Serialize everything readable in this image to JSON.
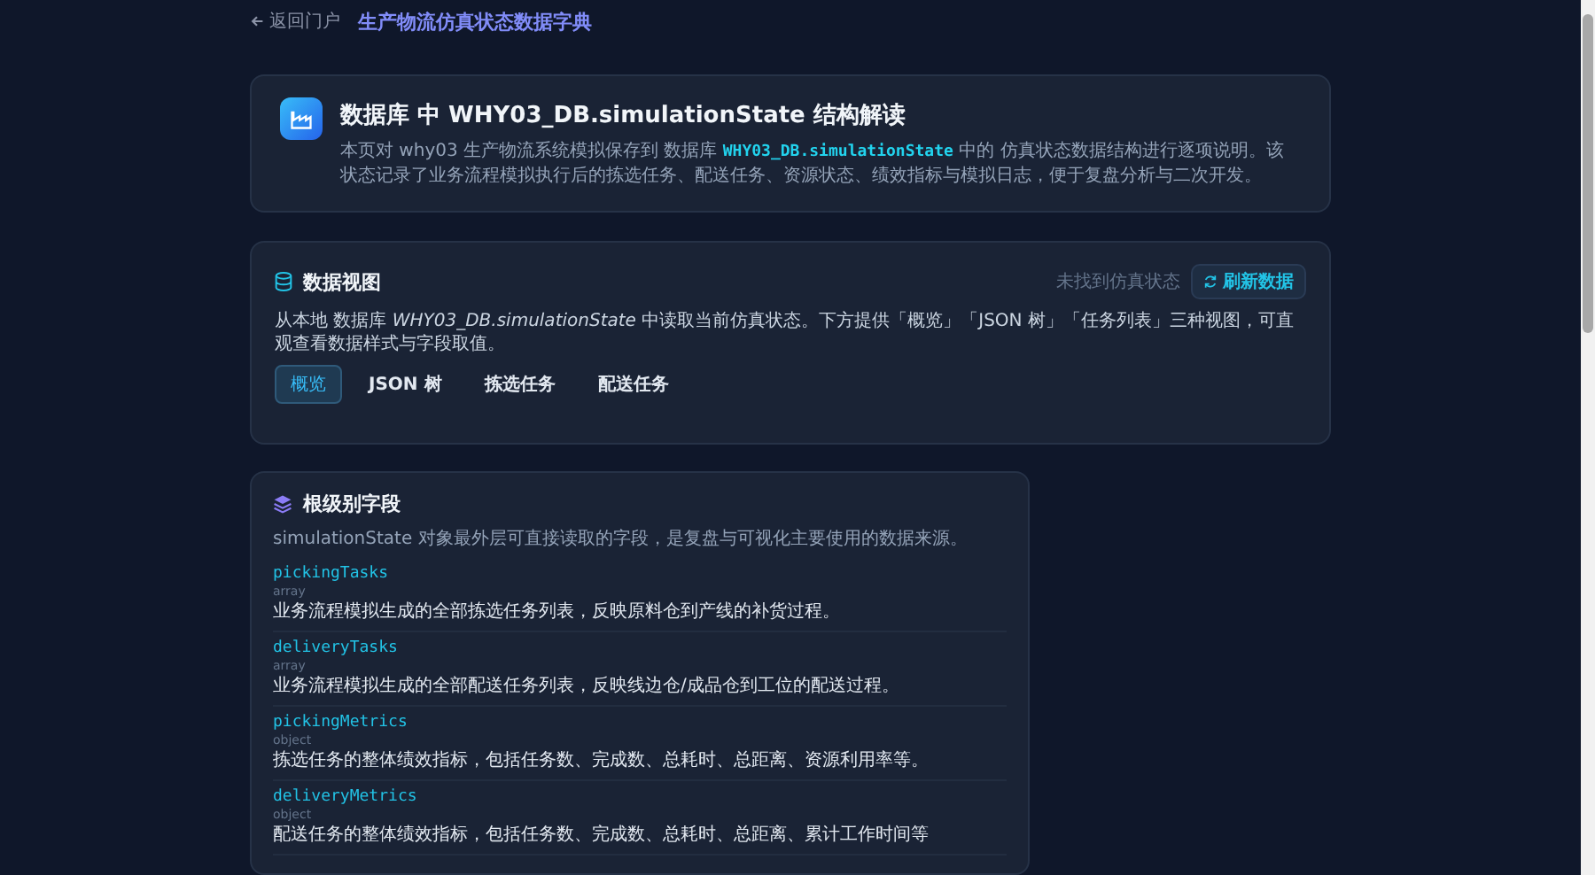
{
  "nav": {
    "back": "返回门户",
    "title": "生产物流仿真状态数据字典"
  },
  "header": {
    "title": "数据库 中 WHY03_DB.simulationState 结构解读",
    "description": "本页对 why03 生产物流系统模拟保存到 数据库 **WHY03_DB.simulationState** 中的 仿真状态数据结构进行逐项说明。该状态记录了业务流程模拟执行后的拣选任务、配送任务、资源状态、绩效指标与模拟日志，便于复盘分析与二次开发。"
  },
  "data_view": {
    "title": "数据视图",
    "status": "未找到仿真状态",
    "refresh_button": "刷新数据",
    "description": "从本地 数据库 *WHY03_DB.simulationState* 中读取当前仿真状态。下方提供「概览」「JSON 树」「任务列表」三种视图，可直观查看数据样式与字段取值。",
    "tabs": [
      {
        "label": "概览",
        "selected": true
      },
      {
        "label": "JSON 树",
        "selected": false
      },
      {
        "label": "拣选任务",
        "selected": false
      },
      {
        "label": "配送任务",
        "selected": false
      }
    ]
  },
  "root_fields": {
    "title": "根级别字段",
    "description": "simulationState 对象最外层可直接读取的字段，是复盘与可视化主要使用的数据来源。",
    "fields": [
      {
        "name": "pickingTasks",
        "type": "array",
        "description": "业务流程模拟生成的全部拣选任务列表，反映原料仓到产线的补货过程。"
      },
      {
        "name": "deliveryTasks",
        "type": "array",
        "description": "业务流程模拟生成的全部配送任务列表，反映线边仓/成品仓到工位的配送过程。"
      },
      {
        "name": "pickingMetrics",
        "type": "object",
        "description": "拣选任务的整体绩效指标，包括任务数、完成数、总耗时、总距离、资源利用率等。"
      },
      {
        "name": "deliveryMetrics",
        "type": "object",
        "description": "配送任务的整体绩效指标，包括任务数、完成数、总耗时、总距离、累计工作时间等"
      }
    ]
  }
}
